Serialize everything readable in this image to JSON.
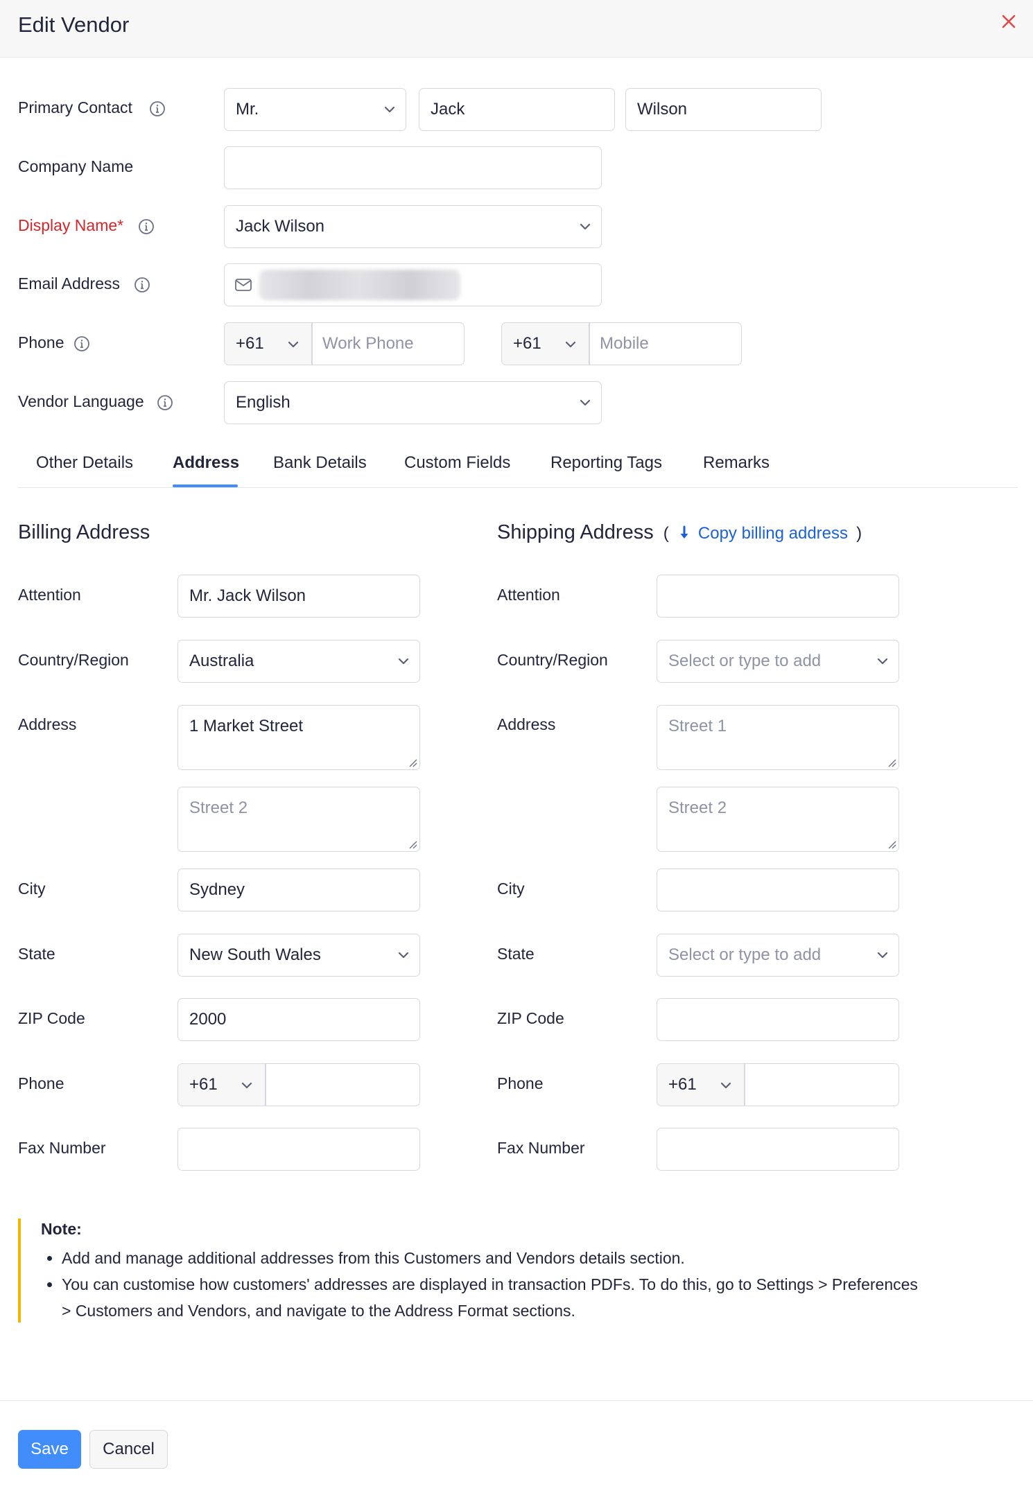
{
  "header": {
    "title": "Edit Vendor"
  },
  "primary_contact": {
    "label": "Primary Contact",
    "salutation": "Mr.",
    "first_name": "Jack",
    "last_name": "Wilson"
  },
  "company_name": {
    "label": "Company Name",
    "value": ""
  },
  "display_name": {
    "label": "Display Name*",
    "value": "Jack Wilson"
  },
  "email": {
    "label": "Email Address"
  },
  "phone": {
    "label": "Phone",
    "work_code": "+61",
    "work_placeholder": "Work Phone",
    "mobile_code": "+61",
    "mobile_placeholder": "Mobile"
  },
  "language": {
    "label": "Vendor Language",
    "value": "English"
  },
  "tabs": [
    "Other Details",
    "Address",
    "Bank Details",
    "Custom Fields",
    "Reporting Tags",
    "Remarks"
  ],
  "active_tab": "Address",
  "billing": {
    "title": "Billing Address",
    "attention_label": "Attention",
    "attention": "Mr. Jack Wilson",
    "country_label": "Country/Region",
    "country": "Australia",
    "address_label": "Address",
    "street1": "1 Market Street",
    "street2_placeholder": "Street 2",
    "city_label": "City",
    "city": "Sydney",
    "state_label": "State",
    "state": "New South Wales",
    "zip_label": "ZIP Code",
    "zip": "2000",
    "phone_label": "Phone",
    "phone_code": "+61",
    "fax_label": "Fax Number"
  },
  "shipping": {
    "title": "Shipping Address",
    "paren_open": "(",
    "copy_link": "Copy billing address",
    "paren_close": ")",
    "attention_label": "Attention",
    "country_label": "Country/Region",
    "country_placeholder": "Select or type to add",
    "address_label": "Address",
    "street1_placeholder": "Street 1",
    "street2_placeholder": "Street 2",
    "city_label": "City",
    "state_label": "State",
    "state_placeholder": "Select or type to add",
    "zip_label": "ZIP Code",
    "phone_label": "Phone",
    "phone_code": "+61",
    "fax_label": "Fax Number"
  },
  "note": {
    "title": "Note:",
    "items": [
      "Add and manage additional addresses from this Customers and Vendors details section.",
      "You can customise how customers' addresses are displayed in transaction PDFs. To do this, go to Settings > Preferences > Customers and Vendors, and navigate to the Address Format sections."
    ]
  },
  "footer": {
    "save": "Save",
    "cancel": "Cancel"
  },
  "colors": {
    "accent": "#408dfb",
    "link": "#1a62d6",
    "required": "#d6262a",
    "note_border": "#f5b400",
    "close": "#e04848"
  },
  "icons": [
    "close-icon",
    "info-icon",
    "chevron-down-icon",
    "mail-icon",
    "arrow-down-icon",
    "resize-handle-icon"
  ]
}
